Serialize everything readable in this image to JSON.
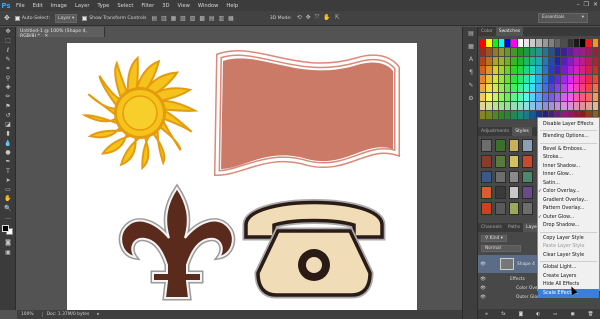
{
  "menubar": {
    "logo": "Ps",
    "items": [
      "File",
      "Edit",
      "Image",
      "Layer",
      "Type",
      "Select",
      "Filter",
      "3D",
      "View",
      "Window",
      "Help"
    ],
    "window_controls": [
      "–",
      "❐",
      "✕"
    ]
  },
  "options": {
    "auto_select_label": "Auto-Select:",
    "auto_select_value": "Layer",
    "transform_label": "Show Transform Controls",
    "mode_3d_label": "3D Mode:",
    "workspace": "Essentials"
  },
  "document": {
    "tab_label": "Untitled-1 @ 100% (Shape 4, RGB/8) *",
    "zoom": "100%",
    "doc_size": "Doc: 1.37M/0 bytes"
  },
  "colors": {
    "canvas_bg": "#ffffff",
    "sun": "#f6c31a",
    "sun_outline": "#e39b10",
    "flag": "#cc7a68",
    "flag_outline": "#f2e4df",
    "fleur": "#5a2a1c",
    "phone": "#f0ddb8",
    "phone_outline": "#2a1b16",
    "menu_highlight": "#3c7fd6"
  },
  "panels": {
    "color_tabs": [
      "Color",
      "Swatches"
    ],
    "adjust_tabs": [
      "Adjustments",
      "Styles"
    ],
    "layers_tabs": [
      "Channels",
      "Paths",
      "Layers"
    ],
    "kind_filter": "Kind",
    "blend_mode": "Normal",
    "layer_name": "Shape 4",
    "effects_label": "Effects",
    "effect_1": "Color Overlay",
    "effect_2": "Outer Glow"
  },
  "context_menu": [
    {
      "label": "Disable Layer Effects",
      "state": "normal"
    },
    {
      "sep": true
    },
    {
      "label": "Blending Options...",
      "state": "normal"
    },
    {
      "sep": true
    },
    {
      "label": "Bevel & Emboss...",
      "state": "normal"
    },
    {
      "label": "Stroke...",
      "state": "normal"
    },
    {
      "label": "Inner Shadow...",
      "state": "normal"
    },
    {
      "label": "Inner Glow...",
      "state": "normal"
    },
    {
      "label": "Satin...",
      "state": "normal"
    },
    {
      "label": "Color Overlay...",
      "state": "checked"
    },
    {
      "label": "Gradient Overlay...",
      "state": "normal"
    },
    {
      "label": "Pattern Overlay...",
      "state": "normal"
    },
    {
      "label": "Outer Glow...",
      "state": "checked"
    },
    {
      "label": "Drop Shadow...",
      "state": "normal"
    },
    {
      "sep": true
    },
    {
      "label": "Copy Layer Style",
      "state": "normal"
    },
    {
      "label": "Paste Layer Style",
      "state": "disabled"
    },
    {
      "label": "Clear Layer Style",
      "state": "normal"
    },
    {
      "sep": true
    },
    {
      "label": "Global Light...",
      "state": "normal"
    },
    {
      "label": "Create Layers",
      "state": "normal"
    },
    {
      "label": "Hide All Effects",
      "state": "normal"
    },
    {
      "label": "Scale Effects...",
      "state": "highlight"
    }
  ]
}
